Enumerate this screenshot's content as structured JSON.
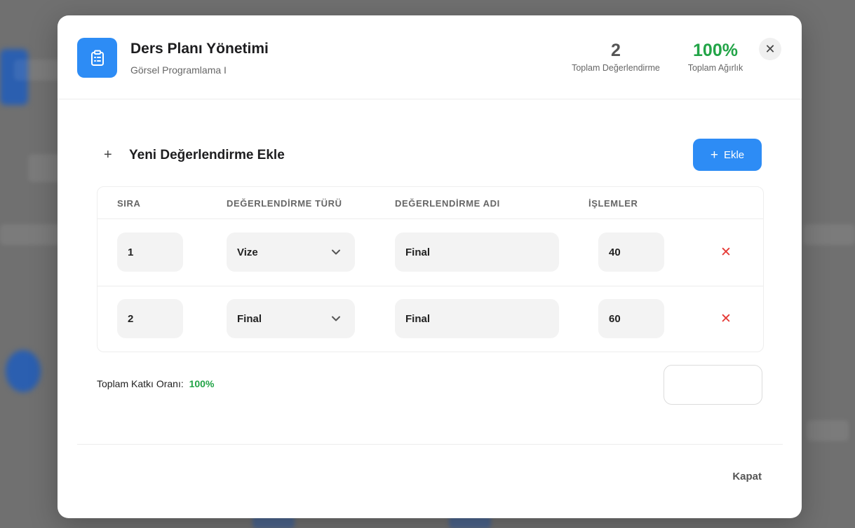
{
  "header": {
    "title": "Ders Planı Yönetimi",
    "subtitle": "Görsel Programlama I",
    "total_count_value": "2",
    "total_count_label": "Toplam Değerlendirme",
    "total_weight_value": "100%",
    "total_weight_label": "Toplam Ağırlık",
    "icon": "clipboard-icon"
  },
  "section": {
    "title": "Yeni Değerlendirme Ekle",
    "add_button_label": "Ekle"
  },
  "table": {
    "columns": [
      "SIRA",
      "DEĞERLENDİRME TÜRÜ",
      "DEĞERLENDİRME ADI",
      "İŞLEMLER"
    ],
    "rows": [
      {
        "order": "1",
        "type": "Vize",
        "name": "Final",
        "weight": "40"
      },
      {
        "order": "2",
        "type": "Final",
        "name": "Final",
        "weight": "60"
      }
    ]
  },
  "summary": {
    "label": "Toplam Katkı Oranı:",
    "value": "100%"
  },
  "footer": {
    "close_label": "Kapat"
  },
  "colors": {
    "accent": "#2d8cf5",
    "success": "#22a447",
    "danger": "#e53935"
  }
}
